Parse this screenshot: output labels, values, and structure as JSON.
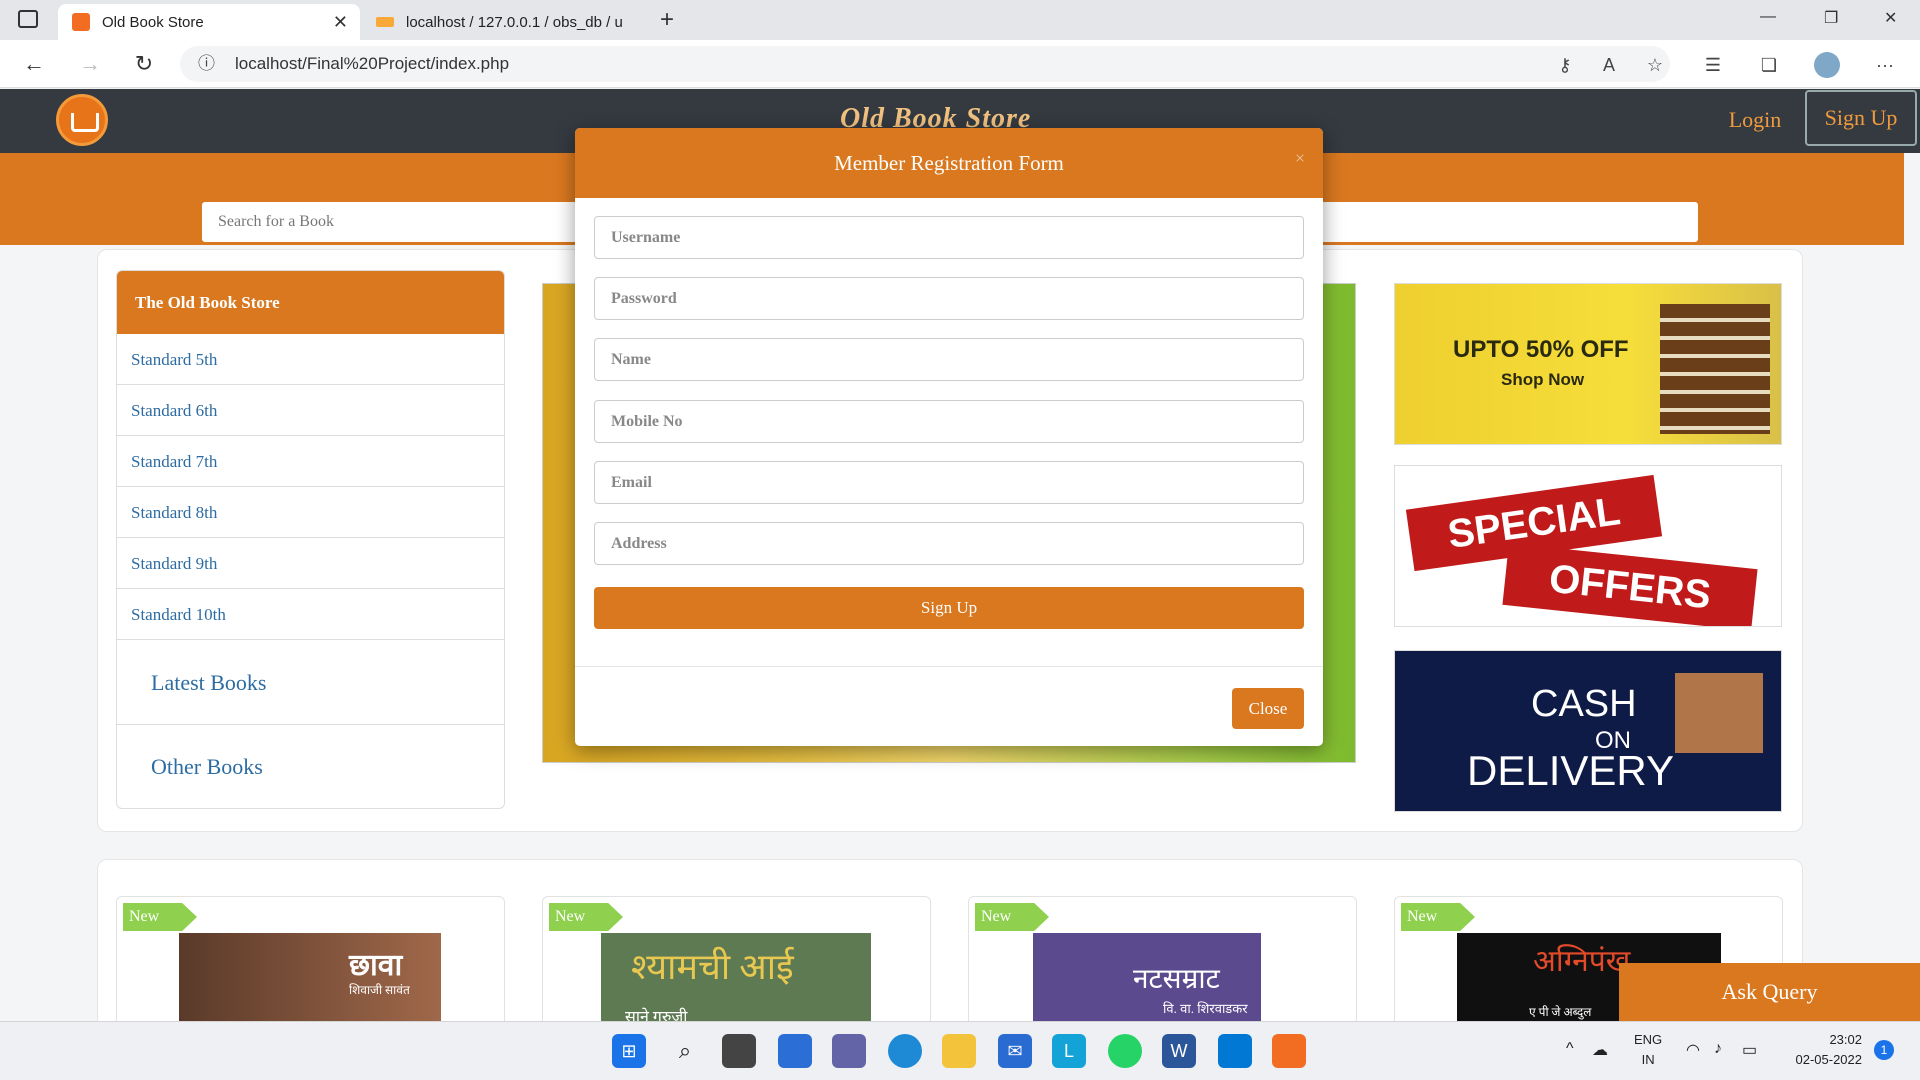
{
  "browser": {
    "tabs": [
      {
        "title": "Old Book Store",
        "active": true
      },
      {
        "title": "localhost / 127.0.0.1 / obs_db / u",
        "active": false
      }
    ],
    "url": "localhost/Final%20Project/index.php",
    "new_tab": "+",
    "window_controls": [
      "—",
      "❐",
      "✕"
    ]
  },
  "site": {
    "brand": "Old Book Store",
    "login": "Login",
    "signup": "Sign Up",
    "search_placeholder": "Search for a Book",
    "sidebar": {
      "heading": "The Old Book Store",
      "items": [
        "Standard 5th",
        "Standard 6th",
        "Standard 7th",
        "Standard 8th",
        "Standard 9th",
        "Standard 10th"
      ],
      "sections": [
        "Latest Books",
        "Other Books"
      ]
    },
    "ads": {
      "ad1_title": "UPTO 50% OFF",
      "ad1_sub": "Shop Now",
      "ad2_line1": "SPECIAL",
      "ad2_line2": "OFFERS",
      "ad3_line1": "CASH",
      "ad3_line2": "ON",
      "ad3_line3": "DELIVERY"
    },
    "products": [
      {
        "tag": "New",
        "cover_text": "छावा",
        "cover_author": "शिवाजी सावंत"
      },
      {
        "tag": "New",
        "cover_text": "श्यामची आई",
        "cover_author": "साने गुरुजी"
      },
      {
        "tag": "New",
        "cover_text": "नटसम्राट",
        "cover_author": "वि. वा. शिरवाडकर"
      },
      {
        "tag": "New",
        "cover_text": "अग्निपंख",
        "cover_author": "ए पी जे अब्दुल"
      }
    ],
    "ask_query": "Ask Query"
  },
  "modal": {
    "title": "Member Registration Form",
    "close_x": "×",
    "fields": [
      "Username",
      "Password",
      "Name",
      "Mobile No",
      "Email",
      "Address"
    ],
    "submit": "Sign Up",
    "close": "Close"
  },
  "taskbar": {
    "lang1": "ENG",
    "lang2": "IN",
    "time": "23:02",
    "date": "02-05-2022",
    "notifications": "1"
  },
  "colors": {
    "accent": "#d9781f",
    "header": "#343a40",
    "link": "#2d6ca2"
  }
}
